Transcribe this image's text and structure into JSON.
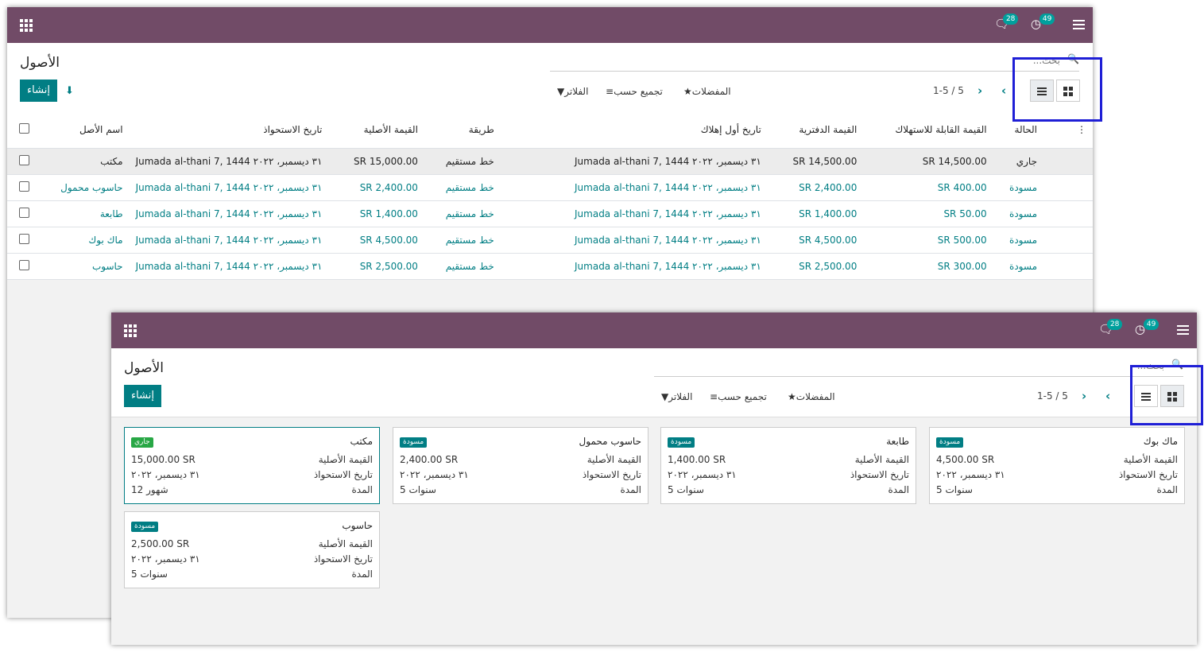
{
  "app": {
    "title": "الأصول",
    "create_label": "إنشاء",
    "chat_count": "28",
    "activity_count": "49"
  },
  "search": {
    "placeholder": "بحث..."
  },
  "filters": {
    "filters_label": "الفلاتر",
    "group_label": "تجميع حسب",
    "fav_label": "المفضلات"
  },
  "pager": {
    "text": "1-5 / 5"
  },
  "columns": [
    "اسم الأصل",
    "تاريخ الاستحواذ",
    "القيمة الأصلية",
    "طريقة",
    "تاريخ أول إهلاك",
    "القيمة الدفترية",
    "القيمة القابلة للاستهلاك",
    "الحالة"
  ],
  "rows": [
    {
      "name": "مكتب",
      "acq": "٣١ ديسمبر، ٢٠٢٢ Jumada al-thani 7, 1444",
      "orig": "15,000.00 SR",
      "method": "خط مستقيم",
      "first": "٣١ ديسمبر، ٢٠٢٢ Jumada al-thani 7, 1444",
      "book": "14,500.00 SR",
      "dep": "14,500.00 SR",
      "state": "جاري"
    },
    {
      "name": "حاسوب محمول",
      "acq": "٣١ ديسمبر، ٢٠٢٢ Jumada al-thani 7, 1444",
      "orig": "2,400.00 SR",
      "method": "خط مستقيم",
      "first": "٣١ ديسمبر، ٢٠٢٢ Jumada al-thani 7, 1444",
      "book": "2,400.00 SR",
      "dep": "400.00 SR",
      "state": "مسودة"
    },
    {
      "name": "طابعة",
      "acq": "٣١ ديسمبر، ٢٠٢٢ Jumada al-thani 7, 1444",
      "orig": "1,400.00 SR",
      "method": "خط مستقيم",
      "first": "٣١ ديسمبر، ٢٠٢٢ Jumada al-thani 7, 1444",
      "book": "1,400.00 SR",
      "dep": "50.00 SR",
      "state": "مسودة"
    },
    {
      "name": "ماك بوك",
      "acq": "٣١ ديسمبر، ٢٠٢٢ Jumada al-thani 7, 1444",
      "orig": "4,500.00 SR",
      "method": "خط مستقيم",
      "first": "٣١ ديسمبر، ٢٠٢٢ Jumada al-thani 7, 1444",
      "book": "4,500.00 SR",
      "dep": "500.00 SR",
      "state": "مسودة"
    },
    {
      "name": "حاسوب",
      "acq": "٣١ ديسمبر، ٢٠٢٢ Jumada al-thani 7, 1444",
      "orig": "2,500.00 SR",
      "method": "خط مستقيم",
      "first": "٣١ ديسمبر، ٢٠٢٢ Jumada al-thani 7, 1444",
      "book": "2,500.00 SR",
      "dep": "300.00 SR",
      "state": "مسودة"
    }
  ],
  "kanban_labels": {
    "orig": "القيمة الأصلية",
    "acq": "تاريخ الاستحواذ",
    "dur": "المدة"
  },
  "cards": [
    {
      "name": "ماك بوك",
      "state": "مسودة",
      "orig": "4,500.00 SR",
      "acq": "٣١ ديسمبر، ٢٠٢٢",
      "dur": "5 سنوات"
    },
    {
      "name": "طابعة",
      "state": "مسودة",
      "orig": "1,400.00 SR",
      "acq": "٣١ ديسمبر، ٢٠٢٢",
      "dur": "5 سنوات"
    },
    {
      "name": "حاسوب محمول",
      "state": "مسودة",
      "orig": "2,400.00 SR",
      "acq": "٣١ ديسمبر، ٢٠٢٢",
      "dur": "5 سنوات"
    },
    {
      "name": "مكتب",
      "state": "جاري",
      "orig": "15,000.00 SR",
      "acq": "٣١ ديسمبر، ٢٠٢٢",
      "dur": "12 شهور"
    },
    {
      "name": "حاسوب",
      "state": "مسودة",
      "orig": "2,500.00 SR",
      "acq": "٣١ ديسمبر، ٢٠٢٢",
      "dur": "5 سنوات"
    }
  ],
  "colors": {
    "brand": "#714b67",
    "accent": "#017e84",
    "highlight": "#1f1fd6"
  }
}
